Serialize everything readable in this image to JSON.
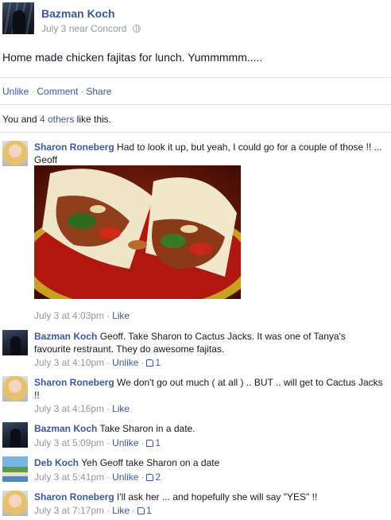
{
  "post": {
    "author": "Bazman Koch",
    "date": "July 3",
    "location_text": "near Concord",
    "text": "Home made chicken fajitas for lunch. Yummmmm.....",
    "actions": {
      "unlike": "Unlike",
      "comment": "Comment",
      "share": "Share"
    },
    "likes": {
      "prefix": "You and",
      "others": "4 others",
      "suffix": "like this."
    }
  },
  "comments": [
    {
      "author": "Sharon Roneberg",
      "text": "Had to look it up, but yeah, I could go for a couple of those !! ... Geoff",
      "time": "July 3 at 4:03pm",
      "action": "Like",
      "likes": "",
      "has_photo": true
    },
    {
      "author": "Bazman Koch",
      "text": "Geoff. Take Sharon to Cactus Jacks. It was one of Tanya's favourite restraunt. They do awesome fajitas.",
      "time": "July 3 at 4:10pm",
      "action": "Unlike",
      "likes": "1"
    },
    {
      "author": "Sharon Roneberg",
      "text": "We don't go out much ( at all ) .. BUT .. will get to Cactus Jacks !!",
      "time": "July 3 at 4:16pm",
      "action": "Like",
      "likes": ""
    },
    {
      "author": "Bazman Koch",
      "text": "Take Sharon in a date.",
      "time": "July 3 at 5:09pm",
      "action": "Unlike",
      "likes": "1"
    },
    {
      "author": "Deb Koch",
      "text": "Yeh Geoff take Sharon on a date",
      "time": "July 3 at 5:41pm",
      "action": "Unlike",
      "likes": "2"
    },
    {
      "author": "Sharon Roneberg",
      "text": "I'll ask her ... and hopefully she will say \"YES\" !!",
      "time": "July 3 at 7:17pm",
      "action": "Like",
      "likes": "1"
    }
  ],
  "colors": {
    "link": "#3b5998",
    "meta": "#9197a3",
    "text": "#141823",
    "divider": "#e5e5e5"
  },
  "icons": {
    "privacy": "globe-icon",
    "like": "thumbs-up-icon"
  }
}
